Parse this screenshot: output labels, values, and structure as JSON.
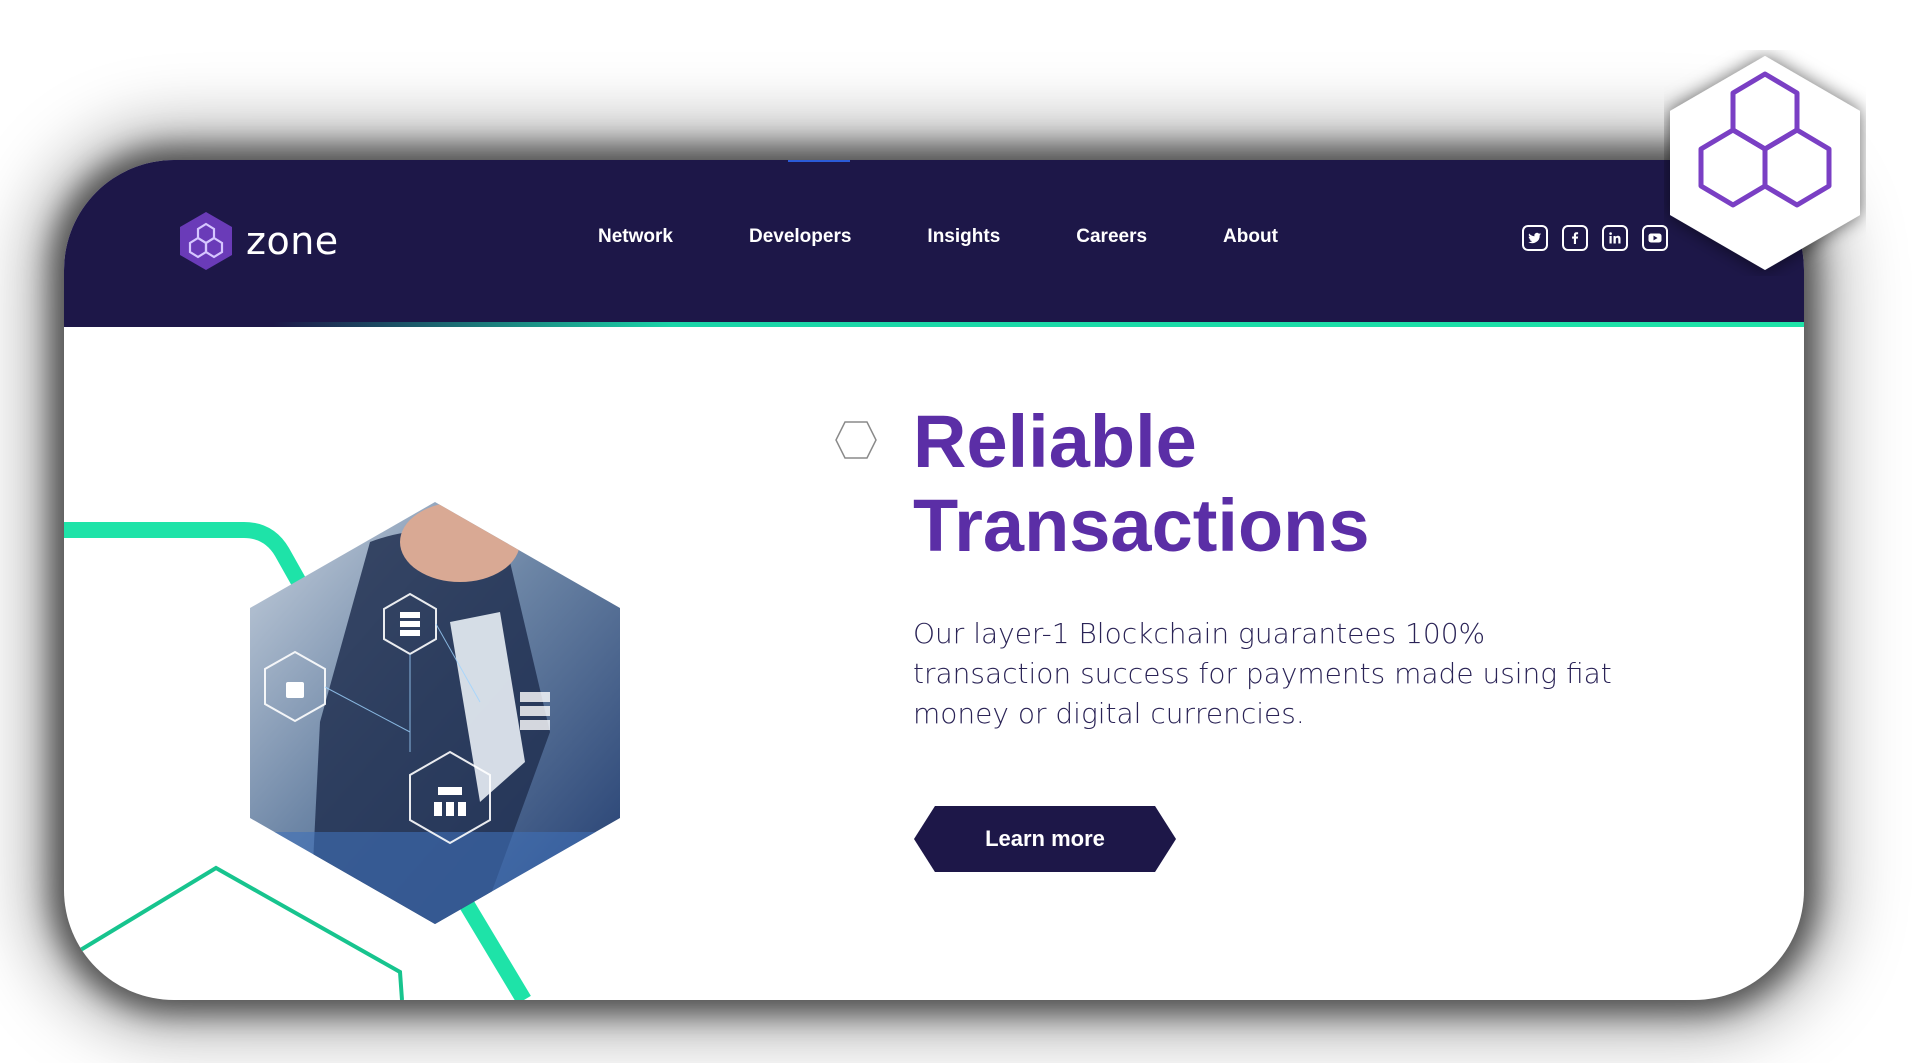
{
  "brand": {
    "name": "zone",
    "accent_color": "#5b2ea6",
    "nav_color": "#1d1748",
    "highlight_color": "#1ee3a8"
  },
  "nav": {
    "items": [
      {
        "label": "Network"
      },
      {
        "label": "Developers"
      },
      {
        "label": "Insights"
      },
      {
        "label": "Careers"
      },
      {
        "label": "About"
      }
    ],
    "social": [
      {
        "icon": "twitter-icon"
      },
      {
        "icon": "facebook-icon"
      },
      {
        "icon": "linkedin-icon"
      },
      {
        "icon": "youtube-icon"
      }
    ]
  },
  "hero": {
    "title_line1": "Reliable",
    "title_line2": "Transactions",
    "description": "Our layer-1 Blockchain guarantees 100% transaction success for payments made using fiat money or digital currencies.",
    "cta_label": "Learn more"
  }
}
